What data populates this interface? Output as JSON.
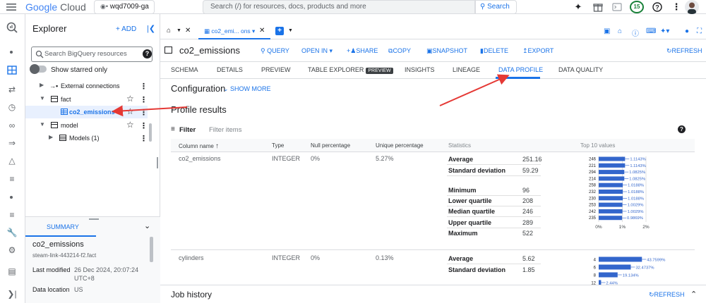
{
  "topbar": {
    "logo_google": "Google",
    "logo_cloud": "Cloud",
    "project": "wqd7009-ga",
    "search_placeholder": "Search (/) for resources, docs, products and more",
    "search_button": "Search",
    "notification_count": "15",
    "icons": [
      "menu-icon",
      "gemini-icon",
      "gift-icon",
      "terminal-icon",
      "help-icon",
      "more-icon"
    ]
  },
  "rail": {
    "icons": [
      "bigquery-logo-icon",
      "dot-icon",
      "dashboard-icon",
      "transfer-icon",
      "history-icon",
      "share-icon",
      "pipeline-icon",
      "workflow-icon",
      "list-icon",
      "dot-icon",
      "list-icon",
      "wrench-icon",
      "settings-icon",
      "notes-icon",
      "collapse-rail-icon"
    ]
  },
  "explorer": {
    "title": "Explorer",
    "add_label": "+ ADD",
    "search_placeholder": "Search BigQuery resources",
    "starred_label": "Show starred only",
    "tree": [
      {
        "label": "External connections"
      },
      {
        "label": "fact"
      },
      {
        "label": "co2_emissions"
      },
      {
        "label": "model"
      },
      {
        "label": "Models (1)"
      }
    ]
  },
  "summary": {
    "tab": "SUMMARY",
    "title": "co2_emissions",
    "subtitle": "steam-link-443214-f2.fact",
    "rows": [
      {
        "label": "Last modified",
        "value": "26 Dec 2024, 20:07:24 UTC+8"
      },
      {
        "label": "Data location",
        "value": "US"
      }
    ]
  },
  "tabstrip": {
    "active_tab": "co2_emi... ons"
  },
  "table": {
    "title": "co2_emissions",
    "actions": [
      "QUERY",
      "OPEN IN",
      "SHARE",
      "COPY",
      "SNAPSHOT",
      "DELETE",
      "EXPORT"
    ],
    "refresh": "REFRESH"
  },
  "subtabs": [
    "SCHEMA",
    "DETAILS",
    "PREVIEW",
    "TABLE EXPLORER",
    "INSIGHTS",
    "LINEAGE",
    "DATA PROFILE",
    "DATA QUALITY"
  ],
  "subtab_badge": "PREVIEW",
  "configuration": {
    "title": "Configuration",
    "show_more": "SHOW MORE"
  },
  "profile": {
    "title": "Profile results",
    "filter_label": "Filter",
    "filter_placeholder": "Filter items",
    "headers": [
      "Column name",
      "Type",
      "Null percentage",
      "Unique percentage",
      "Statistics",
      "Top 10 values"
    ],
    "rows": [
      {
        "column": "co2_emissions",
        "type": "INTEGER",
        "null_pct": "0%",
        "unique_pct": "5.27%",
        "stats": [
          {
            "label": "Average",
            "value": "251.16"
          },
          {
            "label": "Standard deviation",
            "value": "59.29"
          },
          {
            "label": "Minimum",
            "value": "96"
          },
          {
            "label": "Lower quartile",
            "value": "208"
          },
          {
            "label": "Median quartile",
            "value": "246"
          },
          {
            "label": "Upper quartile",
            "value": "289"
          },
          {
            "label": "Maximum",
            "value": "522"
          }
        ]
      },
      {
        "column": "cylinders",
        "type": "INTEGER",
        "null_pct": "0%",
        "unique_pct": "0.13%",
        "stats": [
          {
            "label": "Average",
            "value": "5.62"
          },
          {
            "label": "Standard deviation",
            "value": "1.85"
          }
        ]
      }
    ]
  },
  "job_history": {
    "title": "Job history",
    "refresh": "REFRESH"
  },
  "chart_data": [
    {
      "type": "bar",
      "orientation": "horizontal",
      "title": "",
      "categories": [
        "246",
        "221",
        "294",
        "214",
        "258",
        "232",
        "230",
        "253",
        "242",
        "235"
      ],
      "values": [
        1.1143,
        1.1143,
        1.0825,
        1.0825,
        1.0188,
        1.0188,
        1.0188,
        1.0029,
        1.0029,
        0.9869
      ],
      "labels": [
        "1.1143%",
        "1.1143%",
        "1.0825%",
        "1.0825%",
        "1.0188%",
        "1.0188%",
        "1.0188%",
        "1.0029%",
        "1.0029%",
        "0.9869%"
      ],
      "x_ticks": [
        "0%",
        "1%",
        "2%"
      ],
      "xlim": [
        0,
        2
      ],
      "bar_color": "#3366cc"
    },
    {
      "type": "bar",
      "orientation": "horizontal",
      "title": "",
      "categories": [
        "4",
        "6",
        "8",
        "12"
      ],
      "values": [
        43.7599,
        32.4737,
        19.134,
        2.44
      ],
      "labels": [
        "43.7599%",
        "32.4737%",
        "19.134%",
        "2.44%"
      ],
      "xlim": [
        0,
        100
      ],
      "bar_color": "#3366cc"
    }
  ],
  "colors": {
    "accent": "#1a73e8",
    "bar": "#3366cc",
    "annotation": "#e53935"
  }
}
